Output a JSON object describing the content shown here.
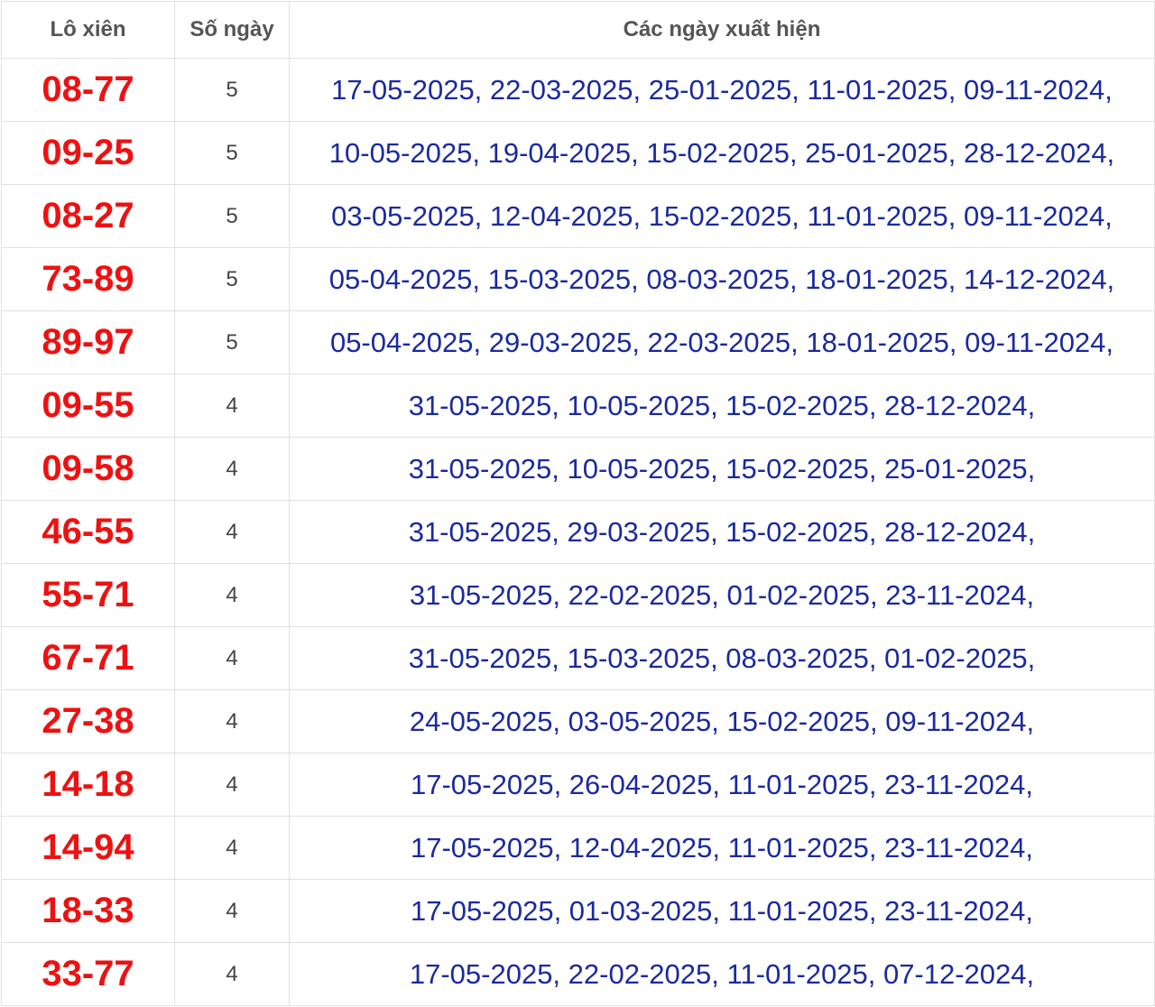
{
  "table": {
    "headers": {
      "pair": "Lô xiên",
      "days": "Số ngày",
      "dates": "Các ngày xuất hiện"
    },
    "rows": [
      {
        "pair": "08-77",
        "days": "5",
        "dates": "17-05-2025, 22-03-2025, 25-01-2025, 11-01-2025, 09-11-2024,"
      },
      {
        "pair": "09-25",
        "days": "5",
        "dates": "10-05-2025, 19-04-2025, 15-02-2025, 25-01-2025, 28-12-2024,"
      },
      {
        "pair": "08-27",
        "days": "5",
        "dates": "03-05-2025, 12-04-2025, 15-02-2025, 11-01-2025, 09-11-2024,"
      },
      {
        "pair": "73-89",
        "days": "5",
        "dates": "05-04-2025, 15-03-2025, 08-03-2025, 18-01-2025, 14-12-2024,"
      },
      {
        "pair": "89-97",
        "days": "5",
        "dates": "05-04-2025, 29-03-2025, 22-03-2025, 18-01-2025, 09-11-2024,"
      },
      {
        "pair": "09-55",
        "days": "4",
        "dates": "31-05-2025, 10-05-2025, 15-02-2025, 28-12-2024,"
      },
      {
        "pair": "09-58",
        "days": "4",
        "dates": "31-05-2025, 10-05-2025, 15-02-2025, 25-01-2025,"
      },
      {
        "pair": "46-55",
        "days": "4",
        "dates": "31-05-2025, 29-03-2025, 15-02-2025, 28-12-2024,"
      },
      {
        "pair": "55-71",
        "days": "4",
        "dates": "31-05-2025, 22-02-2025, 01-02-2025, 23-11-2024,"
      },
      {
        "pair": "67-71",
        "days": "4",
        "dates": "31-05-2025, 15-03-2025, 08-03-2025, 01-02-2025,"
      },
      {
        "pair": "27-38",
        "days": "4",
        "dates": "24-05-2025, 03-05-2025, 15-02-2025, 09-11-2024,"
      },
      {
        "pair": "14-18",
        "days": "4",
        "dates": "17-05-2025, 26-04-2025, 11-01-2025, 23-11-2024,"
      },
      {
        "pair": "14-94",
        "days": "4",
        "dates": "17-05-2025, 12-04-2025, 11-01-2025, 23-11-2024,"
      },
      {
        "pair": "18-33",
        "days": "4",
        "dates": "17-05-2025, 01-03-2025, 11-01-2025, 23-11-2024,"
      },
      {
        "pair": "33-77",
        "days": "4",
        "dates": "17-05-2025, 22-02-2025, 11-01-2025, 07-12-2024,"
      }
    ]
  },
  "colors": {
    "pair": "#ee1111",
    "dates": "#1a2a9e",
    "header": "#555555",
    "border": "#e1e1e1"
  }
}
